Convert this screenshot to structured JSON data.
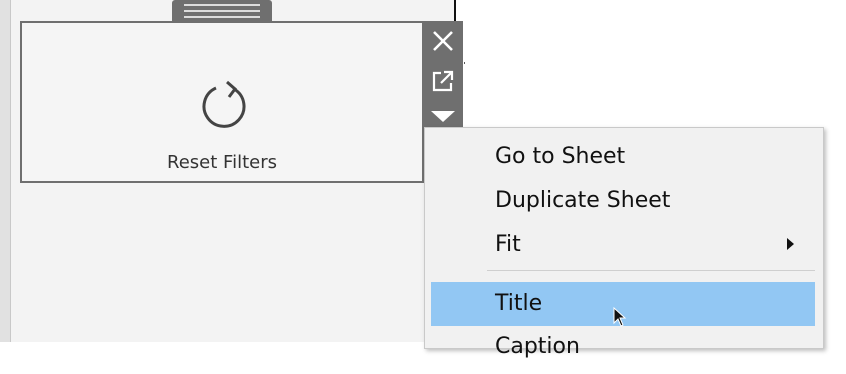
{
  "filter_card": {
    "label": "Reset Filters",
    "icon": "reset-icon"
  },
  "toolbar": {
    "close_icon": "close-icon",
    "popout_icon": "popout-icon",
    "menu_icon": "more-options-arrow-icon"
  },
  "context_menu": {
    "items": [
      {
        "label": "Go to Sheet"
      },
      {
        "label": "Duplicate Sheet"
      },
      {
        "label": "Fit",
        "has_submenu": true
      },
      {
        "label": "Title",
        "highlighted": true
      },
      {
        "label": "Caption"
      }
    ],
    "highlight_color": "#92c7f3"
  },
  "colors": {
    "panel_bg": "#f3f3f3",
    "toolbar_bg": "#6f6f6f",
    "menu_bg": "#f1f1f1"
  }
}
